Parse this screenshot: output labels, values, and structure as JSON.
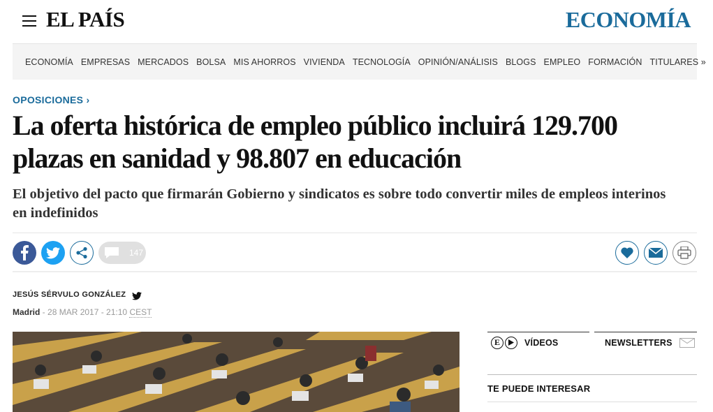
{
  "header": {
    "logo": "EL PAÍS",
    "section": "ECONOMÍA"
  },
  "nav": [
    "ECONOMÍA",
    "EMPRESAS",
    "MERCADOS",
    "BOLSA",
    "MIS AHORROS",
    "VIVIENDA",
    "TECNOLOGÍA",
    "OPINIÓN/ANÁLISIS",
    "BLOGS",
    "EMPLEO",
    "FORMACIÓN",
    "TITULARES »"
  ],
  "article": {
    "kicker": "OPOSICIONES ›",
    "headline": "La oferta histórica de empleo público incluirá 129.700 plazas en sanidad y 98.807 en educación",
    "subtitle": "El objetivo del pacto que firmarán Gobierno y sindicatos es sobre todo convertir miles de empleos interinos en indefinidos",
    "author": "JESÚS SÉRVULO GONZÁLEZ",
    "city": "Madrid",
    "date_sep": " - ",
    "date": "28 MAR 2017 - 21:10",
    "tz": "CEST"
  },
  "social": {
    "comment_count": "147",
    "icons": [
      "facebook-icon",
      "twitter-icon",
      "share-icon",
      "comment-icon"
    ],
    "colors": {
      "facebook": "#3b5998",
      "twitter": "#1da1f2",
      "accent": "#1a6b9b"
    }
  },
  "actions": {
    "icons": [
      "heart-icon",
      "mail-icon",
      "print-icon"
    ]
  },
  "sidebar": {
    "videos_label": "VÍDEOS",
    "newsletters_label": "NEWSLETTERS",
    "interest_label": "TE PUEDE INTERESAR"
  }
}
